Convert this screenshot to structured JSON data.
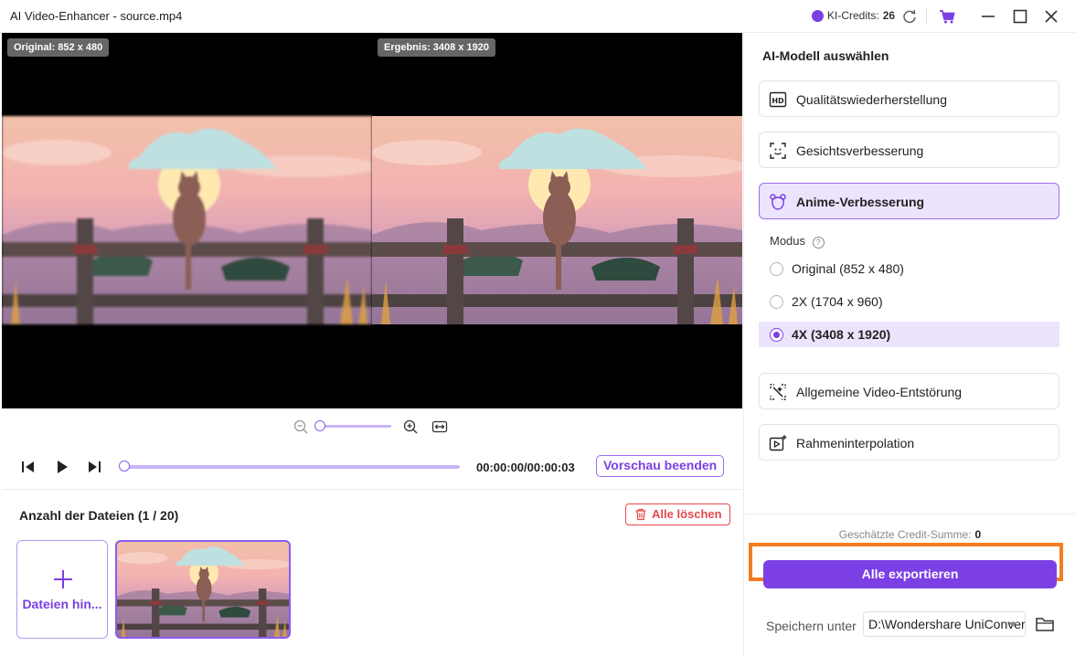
{
  "window": {
    "title": "AI Video-Enhancer - source.mp4",
    "credits_label": "KI-Credits:",
    "credits_value": "26"
  },
  "preview": {
    "original_badge": "Original: 852 x 480",
    "result_badge": "Ergebnis: 3408 x 1920"
  },
  "player": {
    "time": "00:00:00/00:00:03",
    "stop_preview": "Vorschau beenden",
    "progress": 0,
    "zoom_level": 0
  },
  "files": {
    "title": "Anzahl der Dateien (1 / 20)",
    "clear_all": "Alle löschen",
    "add_label": "Dateien hinzufügen"
  },
  "panel": {
    "title": "AI-Modell auswählen",
    "models": [
      {
        "label": "Qualitätswiederherstellung",
        "icon": "hd-icon"
      },
      {
        "label": "Gesichtsverbesserung",
        "icon": "face-scan-icon"
      },
      {
        "label": "Anime-Verbesserung",
        "icon": "anime-bear-icon",
        "active": true
      },
      {
        "label": "Allgemeine Video-Entstörung",
        "icon": "denoise-icon"
      },
      {
        "label": "Rahmeninterpolation",
        "icon": "frame-interpolation-icon"
      }
    ],
    "mode_label": "Modus",
    "mode_help": "?",
    "modes": [
      {
        "label": "Original (852 x 480)"
      },
      {
        "label": "2X (1704 x 960)"
      },
      {
        "label": "4X (3408 x 1920)",
        "selected": true
      }
    ],
    "credit_sum_label": "Geschätzte Credit-Summe:",
    "credit_sum_value": "0",
    "export_label": "Alle exportieren",
    "save_label": "Speichern unter",
    "save_path": "D:\\Wondershare UniConverter"
  },
  "colors": {
    "accent": "#7b3fe4",
    "highlight": "#f57c20",
    "danger": "#e5484d"
  }
}
